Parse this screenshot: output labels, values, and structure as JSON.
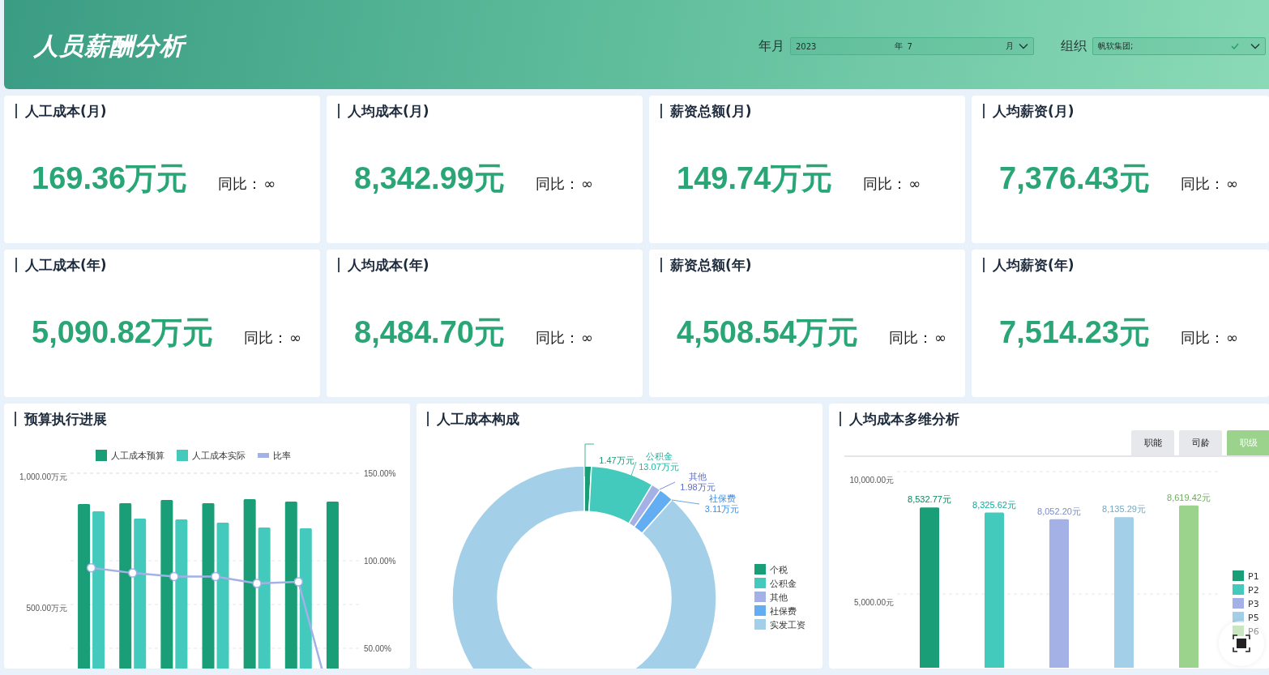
{
  "header": {
    "title": "人员薪酬分析",
    "year_month": {
      "label": "年月",
      "year": "2023",
      "year_unit": "年",
      "month": "7",
      "month_unit": "月"
    },
    "organization": {
      "label": "组织",
      "value": "帆软集团;",
      "checked": true
    }
  },
  "kpi_cards": [
    {
      "title": "人工成本(月)",
      "value": "169.36万元",
      "yoy_label": "同比：",
      "yoy_value": "∞"
    },
    {
      "title": "人均成本(月)",
      "value": "8,342.99元",
      "yoy_label": "同比：",
      "yoy_value": "∞"
    },
    {
      "title": "薪资总额(月)",
      "value": "149.74万元",
      "yoy_label": "同比：",
      "yoy_value": "∞"
    },
    {
      "title": "人均薪资(月)",
      "value": "7,376.43元",
      "yoy_label": "同比：",
      "yoy_value": "∞"
    },
    {
      "title": "人工成本(年)",
      "value": "5,090.82万元",
      "yoy_label": "同比：",
      "yoy_value": "∞"
    },
    {
      "title": "人均成本(年)",
      "value": "8,484.70元",
      "yoy_label": "同比：",
      "yoy_value": "∞"
    },
    {
      "title": "薪资总额(年)",
      "value": "4,508.54万元",
      "yoy_label": "同比：",
      "yoy_value": "∞"
    },
    {
      "title": "人均薪资(年)",
      "value": "7,514.23元",
      "yoy_label": "同比：",
      "yoy_value": "∞"
    }
  ],
  "budget_panel": {
    "title": "预算执行进展",
    "chart_data": {
      "type": "bar",
      "grid": true,
      "legend": true,
      "ylim": [
        0,
        1000
      ],
      "yticks": [
        {
          "value": 500,
          "label": "500.00万元"
        },
        {
          "value": 1000,
          "label": "1,000.00万元"
        }
      ],
      "y2lim": [
        0,
        150
      ],
      "y2ticks": [
        {
          "value": 50,
          "label": "50.00%"
        },
        {
          "value": 100,
          "label": "100.00%"
        },
        {
          "value": 150,
          "label": "150.00%"
        }
      ],
      "series": [
        {
          "name": "人工成本预算",
          "color": "#1a9e78",
          "type": "bar",
          "values": [
            883,
            886,
            898,
            886,
            901,
            892,
            892
          ]
        },
        {
          "name": "人工成本实际",
          "color": "#44c9bd",
          "type": "bar",
          "values": [
            855,
            827,
            824,
            812,
            793,
            790,
            null
          ]
        },
        {
          "name": "比率",
          "color": "#a3b1e6",
          "type": "line",
          "axis": "y2",
          "marker": "circle",
          "values": [
            96,
            93,
            91,
            91,
            87,
            88,
            0
          ]
        }
      ]
    }
  },
  "composition_panel": {
    "title": "人工成本构成",
    "chart_data": {
      "type": "donut",
      "legend": true,
      "categories": [
        "个税",
        "公积金",
        "其他",
        "社保费",
        "实发工资"
      ],
      "values": [
        0.87,
        7.72,
        1.17,
        1.84,
        88.4
      ],
      "colors": [
        "#1a9e78",
        "#44c9bd",
        "#a3b1e6",
        "#63aef2",
        "#a3d0e8"
      ]
    },
    "callouts": [
      {
        "value": "1.47万元",
        "color": "#1a9e78"
      },
      {
        "name": "公积金",
        "value": "13.07万元",
        "color": "#26b3a3"
      },
      {
        "name": "其他",
        "value": "1.98万元",
        "color": "#5b6fd0"
      },
      {
        "name": "社保费",
        "value": "3.11万元",
        "color": "#3b8fe8"
      }
    ]
  },
  "per_capita_panel": {
    "title": "人均成本多维分析",
    "tabs": [
      {
        "label": "职能",
        "selected": false
      },
      {
        "label": "司龄",
        "selected": false
      },
      {
        "label": "职级",
        "selected": true
      }
    ],
    "chart_data": {
      "type": "bar",
      "grid": true,
      "values": [
        8532.77,
        8325.62,
        8052.2,
        8135.29,
        8619.42
      ],
      "ylim": [
        0,
        10000
      ],
      "yticks": [
        {
          "value": 5000,
          "label": "5,000.00元"
        },
        {
          "value": 10000,
          "label": "10,000.00元"
        }
      ],
      "value_labels": [
        "8,532.77元",
        "8,325.62元",
        "8,052.20元",
        "8,135.29元",
        "8,619.42元"
      ]
    },
    "legend": [
      {
        "label": "P1",
        "color": "#1a9e78"
      },
      {
        "label": "P2",
        "color": "#44c9bd"
      },
      {
        "label": "P3",
        "color": "#a3b1e6"
      },
      {
        "label": "P5",
        "color": "#a3d0e8"
      },
      {
        "label": "P6",
        "color": "#9bd38d"
      }
    ]
  }
}
